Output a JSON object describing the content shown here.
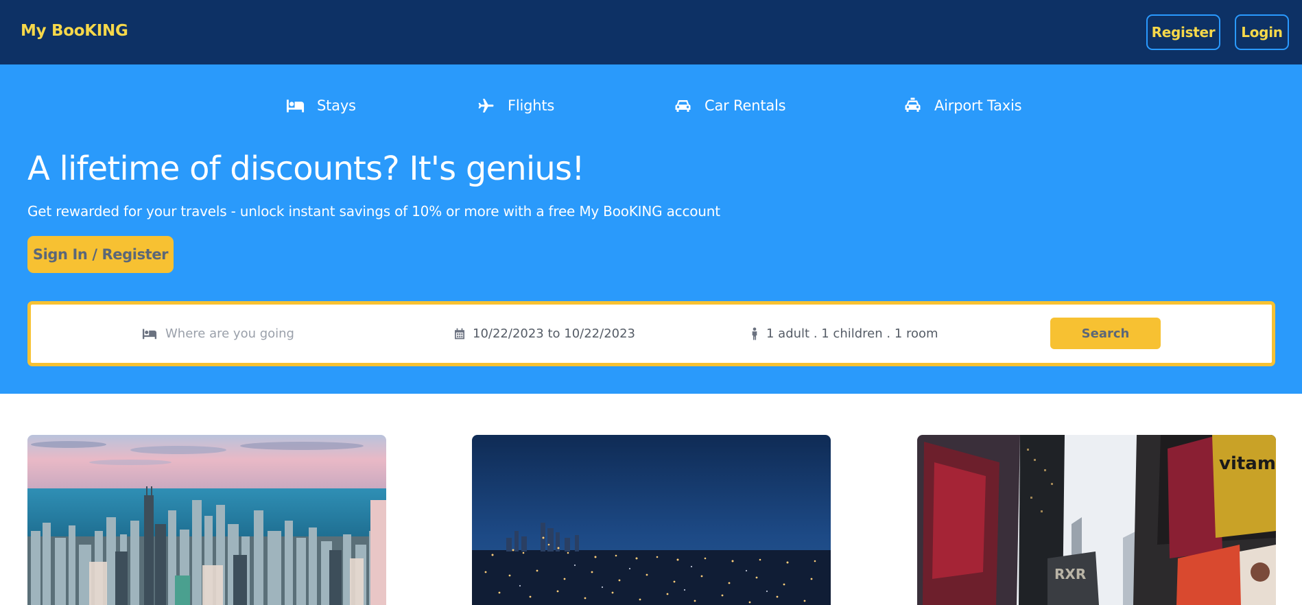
{
  "header": {
    "logo": "My BooKING",
    "register_label": "Register",
    "login_label": "Login"
  },
  "tabs": [
    {
      "label": "Stays",
      "icon": "bed-icon"
    },
    {
      "label": "Flights",
      "icon": "plane-icon"
    },
    {
      "label": "Car Rentals",
      "icon": "car-icon"
    },
    {
      "label": "Airport Taxis",
      "icon": "taxi-icon"
    }
  ],
  "hero": {
    "title": "A lifetime of discounts? It's genius!",
    "subtitle": "Get rewarded for your travels - unlock instant savings of 10% or more with a free My BooKING account",
    "cta_label": "Sign In / Register"
  },
  "search": {
    "destination_placeholder": "Where are you going",
    "destination_value": "",
    "dates": "10/22/2023 to 10/22/2023",
    "guests": "1 adult . 1 children . 1 room",
    "button_label": "Search"
  },
  "featured": [
    {
      "image": "city-skyline-daytime-photo"
    },
    {
      "image": "city-lights-night-photo"
    },
    {
      "image": "times-square-billboards-photo"
    }
  ],
  "colors": {
    "navbar": "#0d3165",
    "hero": "#2a9afb",
    "accent_yellow": "#f7c132",
    "logo_yellow": "#f6d84a"
  }
}
